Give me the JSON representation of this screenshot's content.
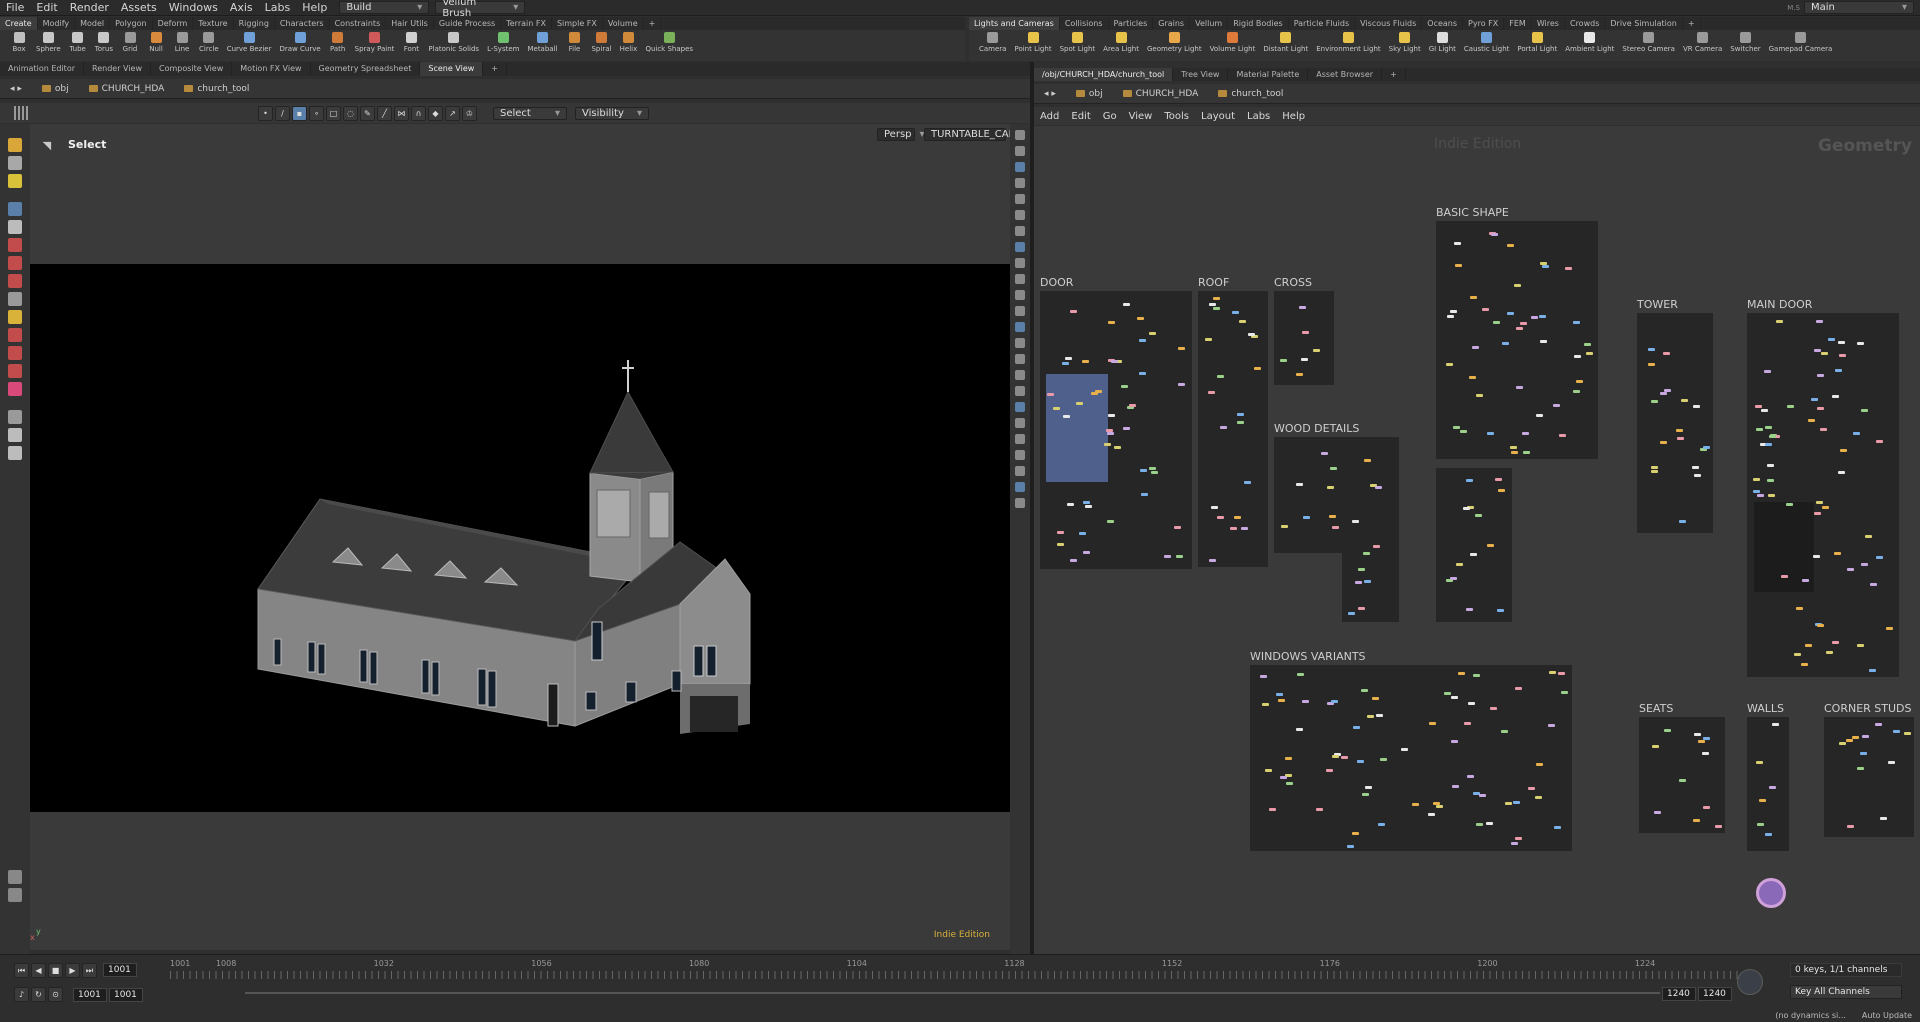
{
  "app": {
    "menu": [
      "File",
      "Edit",
      "Render",
      "Assets",
      "Windows",
      "Axis",
      "Labs",
      "Help"
    ],
    "desktop": "Build",
    "tool_mode": "Vellum Brush",
    "desk_label": "Main",
    "desk_prefix": "M.S"
  },
  "shelf_left": {
    "tabs": [
      "Create",
      "Modify",
      "Model",
      "Polygon",
      "Deform",
      "Texture",
      "Rigging",
      "Characters",
      "Constraints",
      "Hair Utils",
      "Guide Process",
      "Terrain FX",
      "Simple FX",
      "Volume"
    ],
    "tools": [
      {
        "label": "Box",
        "color": "#bfbfbf"
      },
      {
        "label": "Sphere",
        "color": "#c8c8c8"
      },
      {
        "label": "Tube",
        "color": "#c8c8c8"
      },
      {
        "label": "Torus",
        "color": "#c8c8c8"
      },
      {
        "label": "Grid",
        "color": "#9a9a9a"
      },
      {
        "label": "Null",
        "color": "#d98a3c"
      },
      {
        "label": "Line",
        "color": "#9a9a9a"
      },
      {
        "label": "Circle",
        "color": "#9a9a9a"
      },
      {
        "label": "Curve Bezier",
        "color": "#6fa0d8"
      },
      {
        "label": "Draw Curve",
        "color": "#6fa0d8"
      },
      {
        "label": "Path",
        "color": "#d07a3a"
      },
      {
        "label": "Spray Paint",
        "color": "#d05a5a"
      },
      {
        "label": "Font",
        "color": "#d0d0d0"
      },
      {
        "label": "Platonic Solids",
        "color": "#c8c8c8"
      },
      {
        "label": "L-System",
        "color": "#6fc06f"
      },
      {
        "label": "Metaball",
        "color": "#6fa0d8"
      },
      {
        "label": "File",
        "color": "#d08a3a"
      },
      {
        "label": "Spiral",
        "color": "#d07a3a"
      },
      {
        "label": "Helix",
        "color": "#d08a3a"
      },
      {
        "label": "Quick Shapes",
        "color": "#7ab05a"
      }
    ]
  },
  "shelf_right": {
    "tabs": [
      "Lights and Cameras",
      "Collisions",
      "Particles",
      "Grains",
      "Vellum",
      "Rigid Bodies",
      "Particle Fluids",
      "Viscous Fluids",
      "Oceans",
      "Pyro FX",
      "FEM",
      "Wires",
      "Crowds",
      "Drive Simulation"
    ],
    "tools": [
      {
        "label": "Camera",
        "color": "#9a9a9a"
      },
      {
        "label": "Point Light",
        "color": "#e8c34a"
      },
      {
        "label": "Spot Light",
        "color": "#e8c34a"
      },
      {
        "label": "Area Light",
        "color": "#e8c34a"
      },
      {
        "label": "Geometry Light",
        "color": "#e8a84a"
      },
      {
        "label": "Volume Light",
        "color": "#e07a3a"
      },
      {
        "label": "Distant Light",
        "color": "#e8c34a"
      },
      {
        "label": "Environment Light",
        "color": "#e8c34a"
      },
      {
        "label": "Sky Light",
        "color": "#e8c34a"
      },
      {
        "label": "GI Light",
        "color": "#dddddd"
      },
      {
        "label": "Caustic Light",
        "color": "#6fa0d8"
      },
      {
        "label": "Portal Light",
        "color": "#e8c34a"
      },
      {
        "label": "Ambient Light",
        "color": "#e8e8e8"
      },
      {
        "label": "Stereo Camera",
        "color": "#9a9a9a"
      },
      {
        "label": "VR Camera",
        "color": "#9a9a9a"
      },
      {
        "label": "Switcher",
        "color": "#9a9a9a"
      },
      {
        "label": "Gamepad Camera",
        "color": "#9a9a9a"
      }
    ]
  },
  "left_pane": {
    "tabs": [
      "Animation Editor",
      "Render View",
      "Composite View",
      "Motion FX View",
      "Geometry Spreadsheet",
      "Scene View"
    ],
    "path": [
      "obj",
      "CHURCH_HDA",
      "church_tool"
    ],
    "select_dd": "Select",
    "visibility_dd": "Visibility",
    "viewport": {
      "mode_label": "Select",
      "persp": "Persp",
      "camera": "TURNTABLE_CAM",
      "edition": "Indie Edition",
      "axis_y": "y",
      "axis_x": "x"
    }
  },
  "right_pane": {
    "tabs": [
      "/obj/CHURCH_HDA/church_tool",
      "Tree View",
      "Material Palette",
      "Asset Browser"
    ],
    "path": [
      "obj",
      "CHURCH_HDA",
      "church_tool"
    ],
    "menu": [
      "Add",
      "Edit",
      "Go",
      "View",
      "Tools",
      "Layout",
      "Labs",
      "Help"
    ],
    "watermark": "Indie Edition",
    "context": "Geometry",
    "boxes": [
      "DOOR",
      "ROOF",
      "CROSS",
      "BASIC SHAPE",
      "TOWER",
      "MAIN DOOR",
      "WOOD DETAILS",
      "WINDOWS VARIANTS",
      "SEATS",
      "WALLS",
      "CORNER STUDS"
    ]
  },
  "timeline": {
    "current_frame": "1001",
    "start": "1001",
    "start2": "1001",
    "end": "1240",
    "end2": "1240",
    "ticks": [
      "1001",
      "1008",
      "1032",
      "1056",
      "1080",
      "1104",
      "1128",
      "1152",
      "1176",
      "1200",
      "1224"
    ],
    "keys": "0 keys, 1/1 channels",
    "key_all": "Key All Channels",
    "status": "(no dynamics si...",
    "auto_update": "Auto Update"
  }
}
